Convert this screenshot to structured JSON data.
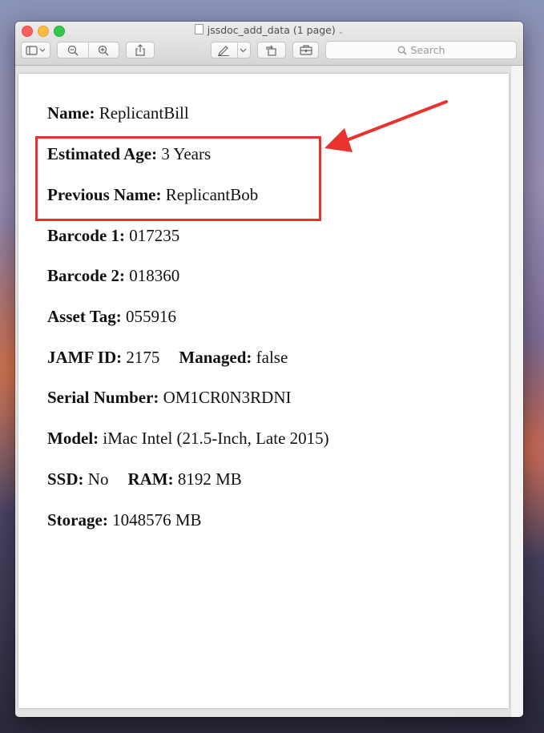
{
  "window": {
    "title": "jssdoc_add_data (1 page)",
    "title_chevron": "⌄"
  },
  "toolbar": {
    "search_placeholder": "Search"
  },
  "document": {
    "name": {
      "label": "Name:",
      "value": " ReplicantBill"
    },
    "estimated_age": {
      "label": "Estimated Age:",
      "value": " 3 Years"
    },
    "previous_name": {
      "label": "Previous Name:",
      "value": " ReplicantBob"
    },
    "barcode1": {
      "label": "Barcode 1:",
      "value": " 017235"
    },
    "barcode2": {
      "label": "Barcode 2:",
      "value": " 018360"
    },
    "asset_tag": {
      "label": "Asset Tag:",
      "value": " 055916"
    },
    "jamf_id": {
      "label": "JAMF ID:",
      "value": " 2175"
    },
    "managed": {
      "label": "Managed:",
      "value": " false"
    },
    "serial": {
      "label": "Serial Number:",
      "value": " OM1CR0N3RDNI"
    },
    "model": {
      "label": "Model:",
      "value": " iMac Intel (21.5-Inch, Late 2015)"
    },
    "ssd": {
      "label": "SSD:",
      "value": " No"
    },
    "ram": {
      "label": "RAM:",
      "value": " 8192 MB"
    },
    "storage": {
      "label": "Storage:",
      "value": " 1048576 MB"
    }
  },
  "annotation": {
    "color": "#e8322d"
  }
}
